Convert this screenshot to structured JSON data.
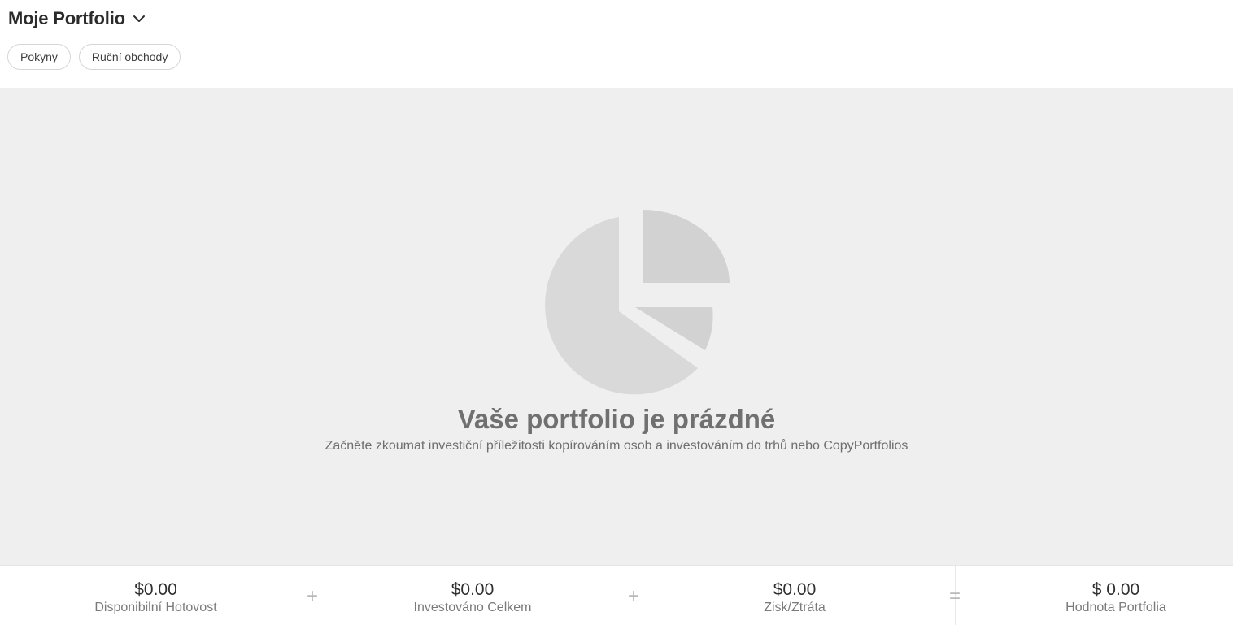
{
  "header": {
    "title": "Moje Portfolio",
    "dropdown_icon": "chevron-down-icon",
    "tabs": [
      {
        "label": "Pokyny"
      },
      {
        "label": "Ruční obchody"
      }
    ]
  },
  "empty_state": {
    "icon": "pie-chart-icon",
    "title": "Vaše portfolio je prázdné",
    "subtitle": "Začněte zkoumat investiční příležitosti kopírováním osob a investováním do trhů nebo CopyPortfolios"
  },
  "footer": {
    "stats": [
      {
        "value": "$0.00",
        "label": "Disponibilní Hotovost"
      },
      {
        "value": "$0.00",
        "label": "Investováno Celkem"
      },
      {
        "value": "$0.00",
        "label": "Zisk/Ztráta"
      },
      {
        "value": "$ 0.00",
        "label": "Hodnota Portfolia"
      }
    ],
    "operators": [
      "+",
      "+",
      "="
    ]
  },
  "colors": {
    "main_background": "#efefef",
    "pie_fill": "#d9d9d9",
    "pie_fill_dark": "#d2d2d2",
    "title_text": "#2b2b2b",
    "empty_title": "#707070"
  }
}
